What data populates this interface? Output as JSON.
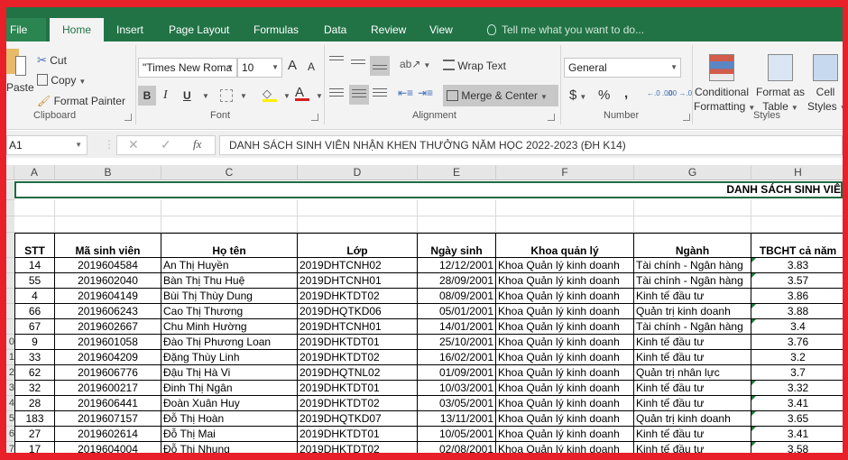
{
  "ribbon_tabs": [
    "File",
    "Home",
    "Insert",
    "Page Layout",
    "Formulas",
    "Data",
    "Review",
    "View"
  ],
  "active_tab": "Home",
  "tell_me": "Tell me what you want to do...",
  "clipboard": {
    "paste": "Paste",
    "cut": "Cut",
    "copy": "Copy",
    "format_painter": "Format Painter",
    "label": "Clipboard"
  },
  "font": {
    "name": "\"Times New Roma",
    "size": "10",
    "label": "Font",
    "bold": "B",
    "italic": "I",
    "underline": "U",
    "grow": "A",
    "shrink": "A",
    "font_color": "A"
  },
  "alignment": {
    "wrap_text": "Wrap Text",
    "merge_center": "Merge & Center",
    "label": "Alignment"
  },
  "number": {
    "format": "General",
    "currency": "$",
    "percent": "%",
    "comma": ",",
    "inc_decimal": "←.0 .00",
    "dec_decimal": ".00 →.0",
    "label": "Number"
  },
  "styles": {
    "conditional_formatting": [
      "Conditional",
      "Formatting"
    ],
    "format_as_table": [
      "Format as",
      "Table"
    ],
    "cell_styles": [
      "Cell",
      "Styles"
    ],
    "label": "Styles"
  },
  "formula_bar": {
    "name_box": "A1",
    "fx": "fx",
    "cancel": "✕",
    "enter": "✓",
    "content": "DANH SÁCH SINH VIÊN NHẬN KHEN THƯỞNG NĂM HỌC 2022-2023 (ĐH K14)"
  },
  "sheet": {
    "columns": [
      "A",
      "B",
      "C",
      "D",
      "E",
      "F",
      "G",
      "H"
    ],
    "title_visible": "DANH SÁCH SINH VIÊ",
    "headers": [
      "STT",
      "Mã sinh viên",
      "Họ tên",
      "Lớp",
      "Ngày sinh",
      "Khoa quản lý",
      "Ngành",
      "TBCHT cả năm"
    ],
    "row_numbers": [
      "",
      "",
      "",
      "",
      "",
      "",
      "0",
      "1",
      "2",
      "3",
      "4",
      "5",
      "6",
      "7"
    ],
    "rows": [
      [
        "14",
        "2019604584",
        "An Thị Huyền",
        "2019DHTCNH02",
        "12/12/2001",
        "Khoa Quản lý kinh doanh",
        "Tài chính - Ngân hàng",
        "3.83"
      ],
      [
        "55",
        "2019602040",
        "Bàn Thị Thu Huệ",
        "2019DHTCNH01",
        "28/09/2001",
        "Khoa Quản lý kinh doanh",
        "Tài chính - Ngân hàng",
        "3.57"
      ],
      [
        "4",
        "2019604149",
        "Bùi Thị Thùy Dung",
        "2019DHKTDT02",
        "08/09/2001",
        "Khoa Quản lý kinh doanh",
        "Kinh tế đầu tư",
        "3.86"
      ],
      [
        "66",
        "2019606243",
        "Cao Thị Thương",
        "2019DHQTKD06",
        "05/01/2001",
        "Khoa Quản lý kinh doanh",
        "Quản trị kinh doanh",
        "3.88"
      ],
      [
        "67",
        "2019602667",
        "Chu Minh Hường",
        "2019DHTCNH01",
        "14/01/2001",
        "Khoa Quản lý kinh doanh",
        "Tài chính - Ngân hàng",
        "3.4"
      ],
      [
        "9",
        "2019601058",
        "Đào Thị Phương Loan",
        "2019DHKTDT01",
        "25/10/2001",
        "Khoa Quản lý kinh doanh",
        "Kinh tế đầu tư",
        "3.76"
      ],
      [
        "33",
        "2019604209",
        "Đặng Thùy Linh",
        "2019DHKTDT02",
        "16/02/2001",
        "Khoa Quản lý kinh doanh",
        "Kinh tế đầu tư",
        "3.2"
      ],
      [
        "62",
        "2019606776",
        "Đậu Thị Hà Vi",
        "2019DHQTNL02",
        "01/09/2001",
        "Khoa Quản lý kinh doanh",
        "Quản trị nhân lực",
        "3.7"
      ],
      [
        "32",
        "2019600217",
        "Đinh Thị Ngân",
        "2019DHKTDT01",
        "10/03/2001",
        "Khoa Quản lý kinh doanh",
        "Kinh tế đầu tư",
        "3.32"
      ],
      [
        "28",
        "2019606441",
        "Đoàn Xuân Huy",
        "2019DHKTDT02",
        "03/05/2001",
        "Khoa Quản lý kinh doanh",
        "Kinh tế đầu tư",
        "3.41"
      ],
      [
        "183",
        "2019607157",
        "Đỗ Thị Hoàn",
        "2019DHQTKD07",
        "13/11/2001",
        "Khoa Quản lý kinh doanh",
        "Quản trị kinh doanh",
        "3.65"
      ],
      [
        "27",
        "2019602614",
        "Đỗ Thị Mai",
        "2019DHKTDT01",
        "10/05/2001",
        "Khoa Quản lý kinh doanh",
        "Kinh tế đầu tư",
        "3.41"
      ],
      [
        "17",
        "2019604004",
        "Đỗ Thị Nhung",
        "2019DHKTDT02",
        "02/08/2001",
        "Khoa Quản lý kinh doanh",
        "Kinh tế đầu tư",
        "3.58"
      ]
    ]
  },
  "colors": {
    "excel_green": "#217346",
    "frame_red": "#e8202a"
  }
}
